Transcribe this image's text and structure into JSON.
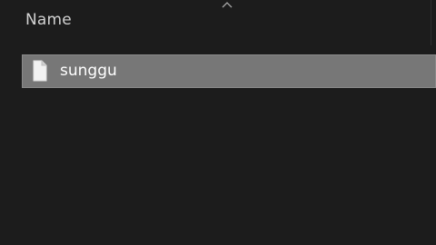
{
  "file_list": {
    "columns": [
      {
        "label": "Name",
        "sort": "ascending"
      }
    ],
    "rows": [
      {
        "name": "sunggu",
        "type": "file",
        "selected": true
      }
    ]
  },
  "icons": {
    "sort_indicator": "chevron-up-icon",
    "file": "document-icon"
  },
  "colors": {
    "background": "#1c1c1c",
    "header_text": "#d2d2d2",
    "selected_row": "#777777",
    "file_text": "#ffffff"
  }
}
